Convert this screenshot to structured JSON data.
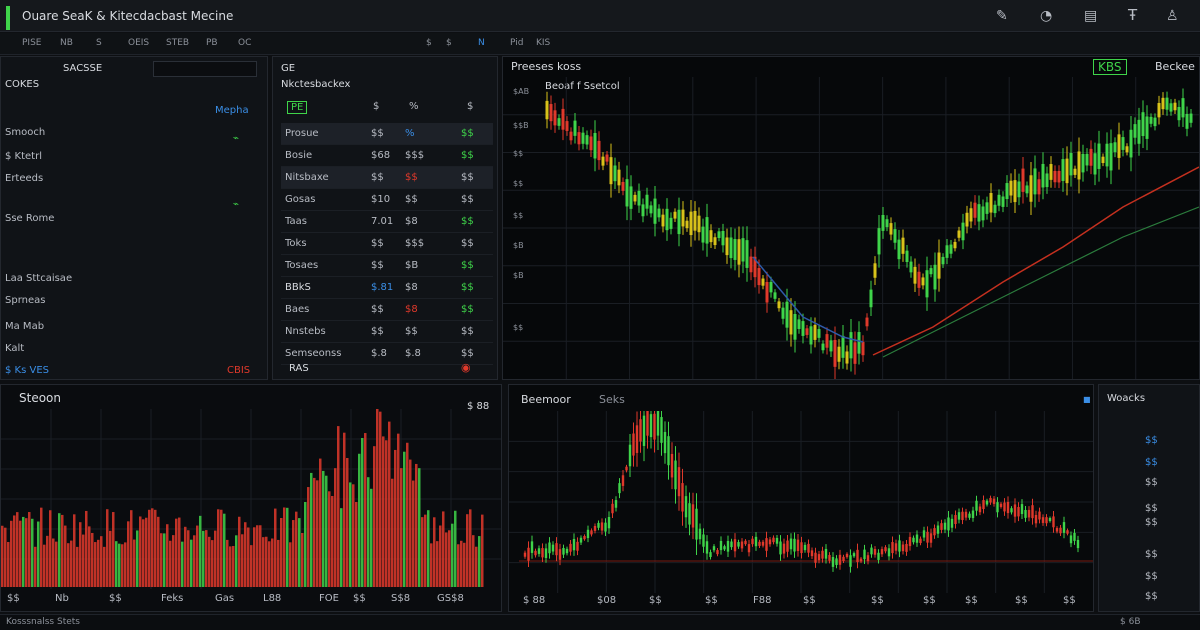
{
  "window": {
    "title": "Ouare SeaK & Kitecdacbast Mecine",
    "toolbar_icons": [
      "pen-icon",
      "gauge-icon",
      "chart-icon",
      "text-icon",
      "user-icon"
    ]
  },
  "toolbar": {
    "items": [
      "PISE",
      "NB",
      "S",
      "OEIS",
      "STEB",
      "PB",
      "OC"
    ],
    "right_items": [
      "$",
      "$",
      "N",
      "Pid",
      "KIS"
    ]
  },
  "left_panel": {
    "header": "SACSSE",
    "heading": "COKES",
    "items": [
      {
        "label": "Mepha",
        "color": "#3a8ee6"
      },
      {
        "label": "Smooch",
        "color": "#b8bcc4"
      },
      {
        "label": "$ Ktetrl",
        "color": "#b8bcc4"
      },
      {
        "label": "Erteeds",
        "color": "#b8bcc4"
      },
      {
        "label": "Sse Rome",
        "color": "#b8bcc4"
      },
      {
        "label": "Laa Sttcaisae",
        "color": "#b8bcc4"
      },
      {
        "label": "Sprneas",
        "color": "#b8bcc4"
      },
      {
        "label": "Ma Mab",
        "color": "#b8bcc4"
      },
      {
        "label": "Kalt",
        "color": "#b8bcc4"
      }
    ],
    "footer_left": "$ Ks VES",
    "footer_right": "CBIS"
  },
  "watchlist": {
    "title": "GE",
    "subtitle": "Nkctesbackex",
    "columns": [
      "PE",
      "$",
      "%",
      "$"
    ],
    "rows": [
      {
        "name": "Prosue",
        "price": "$$",
        "chg": "%",
        "vol": "$$"
      },
      {
        "name": "Bosie",
        "price": "$68",
        "chg": "$$$",
        "vol": "$$"
      },
      {
        "name": "Nitsbaxe",
        "price": "$$",
        "chg": "$$",
        "vol": "$$"
      },
      {
        "name": "Gosas",
        "price": "$10",
        "chg": "$$",
        "vol": "$$"
      },
      {
        "name": "Taas",
        "price": "7.01",
        "chg": "$8",
        "vol": "$$"
      },
      {
        "name": "Toks",
        "price": "$$",
        "chg": "$$$",
        "vol": "$$"
      },
      {
        "name": "Tosaes",
        "price": "$$",
        "chg": "$B",
        "vol": "$$"
      },
      {
        "name": "BBkS",
        "price": "$.81",
        "chg": "$8",
        "vol": "$$"
      },
      {
        "name": "Baes",
        "price": "$$",
        "chg": "$8",
        "vol": "$$"
      },
      {
        "name": "Nnstebs",
        "price": "$$",
        "chg": "$$",
        "vol": "$$"
      },
      {
        "name": "Semseonss",
        "price": "$.8",
        "chg": "$.8",
        "vol": "$$"
      }
    ],
    "footer": "RAS"
  },
  "main_chart": {
    "header": "Preeses koss",
    "legend": "Beoaf f Ssetcol",
    "right_badge": "KBS",
    "right_label": "Beckee",
    "y_labels": [
      "$AB",
      "$$B",
      "$$",
      "$$",
      "$$",
      "$B",
      "$B",
      "$$"
    ],
    "x_labels": [
      "$",
      "$",
      "$",
      "$",
      "$",
      "$",
      "$",
      "$",
      "$",
      "$",
      "$",
      "$"
    ]
  },
  "volume_chart": {
    "title": "Steoon",
    "right_label": "$ 88",
    "x_labels": [
      "$$",
      "Nb",
      "$$",
      "Feks",
      "Gas",
      "L88",
      "FOE",
      "$$",
      "S$8",
      "GS$8"
    ]
  },
  "bottom_chart": {
    "title": "Beemoor",
    "subtitle": "Seks",
    "x_labels": [
      "$ 88",
      "$08",
      "$$",
      "$$",
      "F88",
      "$$",
      "$$",
      "$$",
      "$$",
      "$$",
      "$$"
    ]
  },
  "right_panel": {
    "title": "Woacks",
    "values": [
      "$$",
      "$$",
      "$$",
      "$$",
      "$$",
      "$$",
      "$$",
      "$$"
    ]
  },
  "status_bar": {
    "left": "Kosssnalss Stets",
    "right": "$ 6B"
  },
  "colors": {
    "up": "#3fd44a",
    "down": "#e0392b",
    "accent": "#3a8ee6",
    "background": "#0d0f12"
  }
}
